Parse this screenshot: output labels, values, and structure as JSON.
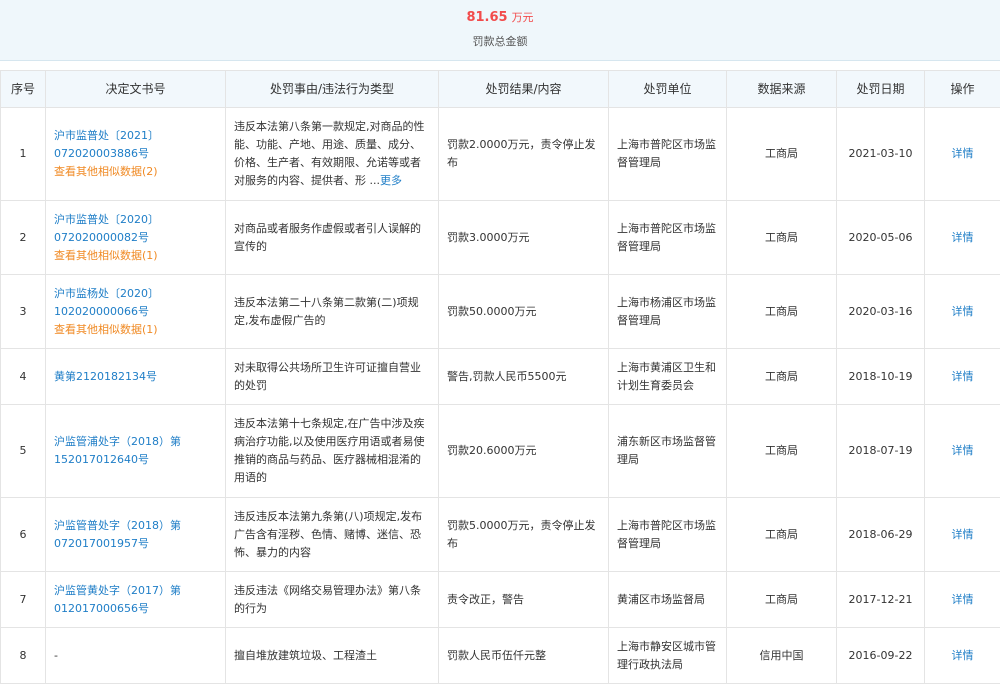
{
  "summary": {
    "amount": "81.65",
    "unit": "万元",
    "label": "罚款总金额"
  },
  "headers": [
    "序号",
    "决定文书号",
    "处罚事由/违法行为类型",
    "处罚结果/内容",
    "处罚单位",
    "数据来源",
    "处罚日期",
    "操作"
  ],
  "rows": [
    {
      "no": "1",
      "doc": "沪市监普处〔2021〕072020003886号",
      "similar": "查看其他相似数据(2)",
      "reason": "违反本法第八条第一款规定,对商品的性能、功能、产地、用途、质量、成分、价格、生产者、有效期限、允诺等或者对服务的内容、提供者、形 ...",
      "more": "更多",
      "result": "罚款2.0000万元，责令停止发布",
      "unit": "上海市普陀区市场监督管理局",
      "source": "工商局",
      "date": "2021-03-10",
      "op": "详情"
    },
    {
      "no": "2",
      "doc": "沪市监普处〔2020〕072020000082号",
      "similar": "查看其他相似数据(1)",
      "reason": "对商品或者服务作虚假或者引人误解的宣传的",
      "more": "",
      "result": "罚款3.0000万元",
      "unit": "上海市普陀区市场监督管理局",
      "source": "工商局",
      "date": "2020-05-06",
      "op": "详情"
    },
    {
      "no": "3",
      "doc": "沪市监杨处〔2020〕102020000066号",
      "similar": "查看其他相似数据(1)",
      "reason": "违反本法第二十八条第二款第(二)项规定,发布虚假广告的",
      "more": "",
      "result": "罚款50.0000万元",
      "unit": "上海市杨浦区市场监督管理局",
      "source": "工商局",
      "date": "2020-03-16",
      "op": "详情"
    },
    {
      "no": "4",
      "doc": "黄第2120182134号",
      "similar": "",
      "reason": "对未取得公共场所卫生许可证擅自营业的处罚",
      "more": "",
      "result": "警告,罚款人民币5500元",
      "unit": "上海市黄浦区卫生和计划生育委员会",
      "source": "工商局",
      "date": "2018-10-19",
      "op": "详情"
    },
    {
      "no": "5",
      "doc": "沪监管浦处字（2018）第152017012640号",
      "similar": "",
      "reason": "违反本法第十七条规定,在广告中涉及疾病治疗功能,以及使用医疗用语或者易使推销的商品与药品、医疗器械相混淆的用语的",
      "more": "",
      "result": "罚款20.6000万元",
      "unit": "浦东新区市场监督管理局",
      "source": "工商局",
      "date": "2018-07-19",
      "op": "详情"
    },
    {
      "no": "6",
      "doc": "沪监管普处字（2018）第072017001957号",
      "similar": "",
      "reason": "违反违反本法第九条第(八)项规定,发布广告含有淫秽、色情、赌博、迷信、恐怖、暴力的内容",
      "more": "",
      "result": "罚款5.0000万元，责令停止发布",
      "unit": "上海市普陀区市场监督管理局",
      "source": "工商局",
      "date": "2018-06-29",
      "op": "详情"
    },
    {
      "no": "7",
      "doc": "沪监管黄处字（2017）第012017000656号",
      "similar": "",
      "reason": "违反违法《网络交易管理办法》第八条的行为",
      "more": "",
      "result": "责令改正，警告",
      "unit": "黄浦区市场监督局",
      "source": "工商局",
      "date": "2017-12-21",
      "op": "详情"
    },
    {
      "no": "8",
      "doc": "-",
      "similar": "",
      "reason": "擅自堆放建筑垃圾、工程渣土",
      "more": "",
      "result": "罚款人民币伍仟元整",
      "unit": "上海市静安区城市管理行政执法局",
      "source": "信用中国",
      "date": "2016-09-22",
      "op": "详情"
    }
  ]
}
